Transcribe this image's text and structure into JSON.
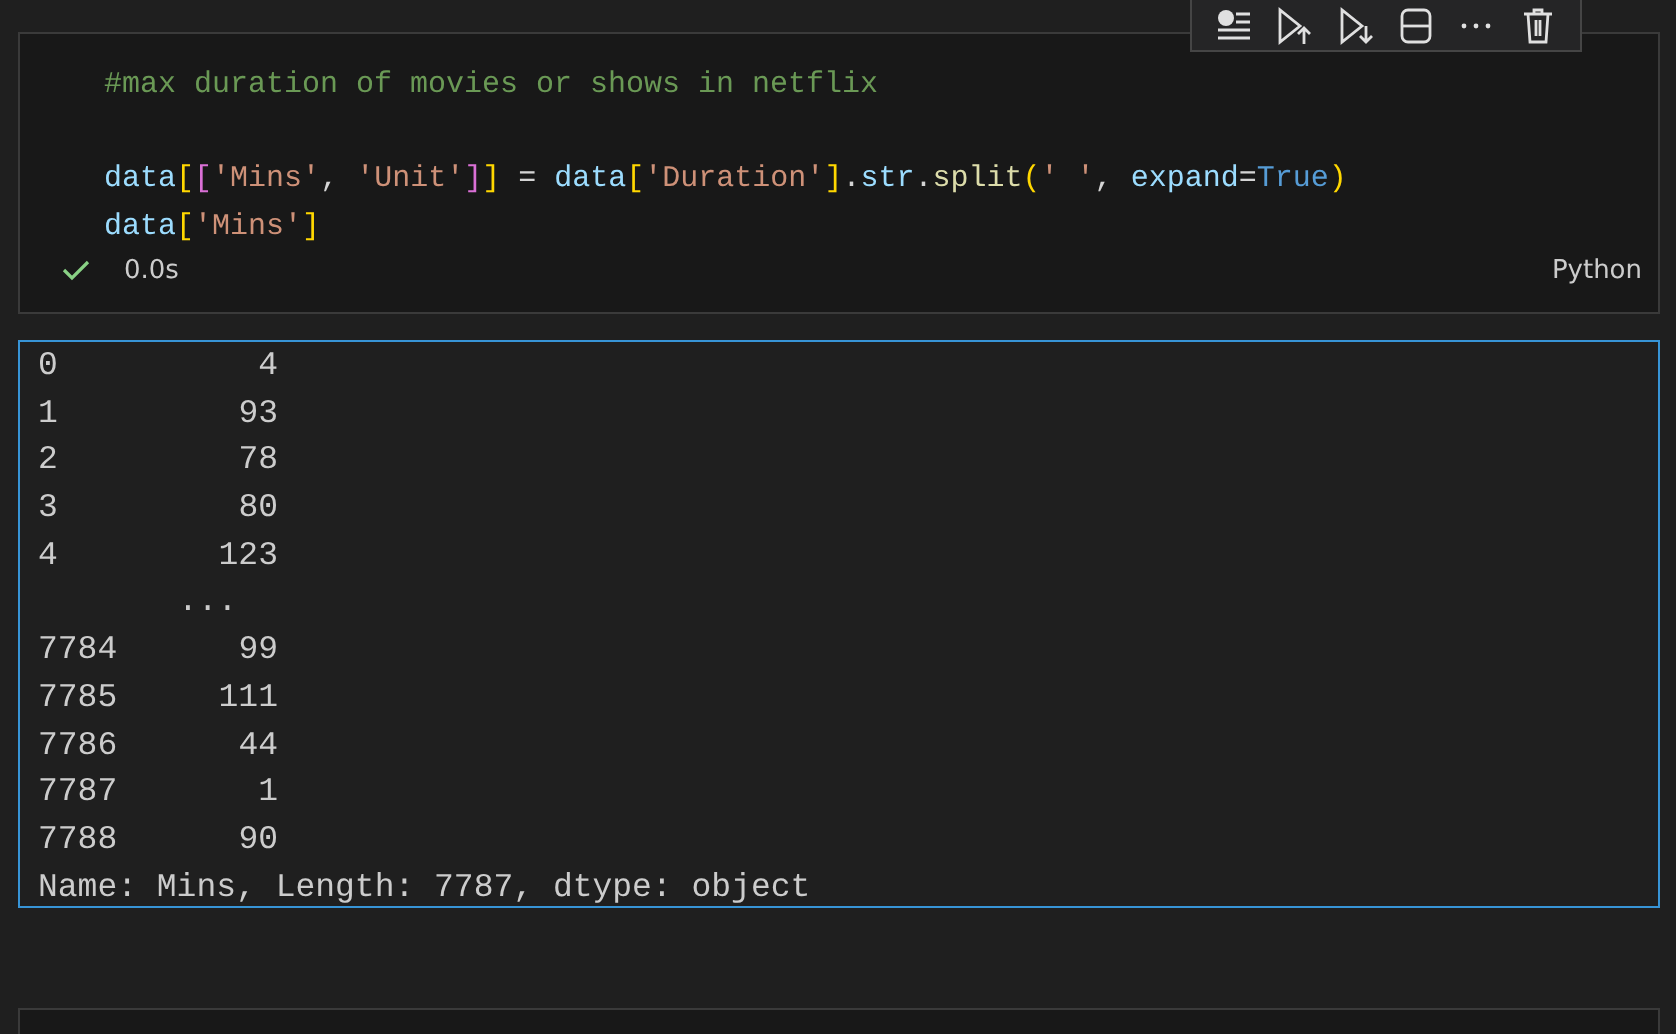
{
  "cell": {
    "code_lines": [
      {
        "kind": "code",
        "tokens": [
          {
            "kind": "comment",
            "text": "#max duration of movies or shows in netflix"
          }
        ]
      },
      {
        "kind": "blank"
      },
      {
        "kind": "code",
        "tokens": [
          {
            "kind": "var",
            "text": "data"
          },
          {
            "kind": "bracket1",
            "text": "["
          },
          {
            "kind": "bracket2",
            "text": "["
          },
          {
            "kind": "string",
            "text": "'Mins'"
          },
          {
            "kind": "plain",
            "text": ", "
          },
          {
            "kind": "string",
            "text": "'Unit'"
          },
          {
            "kind": "bracket2",
            "text": "]"
          },
          {
            "kind": "bracket1",
            "text": "]"
          },
          {
            "kind": "plain",
            "text": " = "
          },
          {
            "kind": "var",
            "text": "data"
          },
          {
            "kind": "bracket1",
            "text": "["
          },
          {
            "kind": "string",
            "text": "'Duration'"
          },
          {
            "kind": "bracket1",
            "text": "]"
          },
          {
            "kind": "plain",
            "text": "."
          },
          {
            "kind": "var",
            "text": "str"
          },
          {
            "kind": "plain",
            "text": "."
          },
          {
            "kind": "func",
            "text": "split"
          },
          {
            "kind": "bracket1",
            "text": "("
          },
          {
            "kind": "string",
            "text": "' '"
          },
          {
            "kind": "plain",
            "text": ", "
          },
          {
            "kind": "var",
            "text": "expand"
          },
          {
            "kind": "plain",
            "text": "="
          },
          {
            "kind": "keyword",
            "text": "True"
          },
          {
            "kind": "bracket1",
            "text": ")"
          }
        ]
      },
      {
        "kind": "code",
        "tokens": [
          {
            "kind": "var",
            "text": "data"
          },
          {
            "kind": "bracket1",
            "text": "["
          },
          {
            "kind": "string",
            "text": "'Mins'"
          },
          {
            "kind": "bracket1",
            "text": "]"
          }
        ]
      }
    ],
    "status": {
      "succeeded": true,
      "duration": "0.0s"
    },
    "language": "Python"
  },
  "output": {
    "rows": [
      {
        "kind": "row",
        "index": "0",
        "value": "4"
      },
      {
        "kind": "row",
        "index": "1",
        "value": "93"
      },
      {
        "kind": "row",
        "index": "2",
        "value": "78"
      },
      {
        "kind": "row",
        "index": "3",
        "value": "80"
      },
      {
        "kind": "row",
        "index": "4",
        "value": "123"
      },
      {
        "kind": "ellipsis",
        "value": "..."
      },
      {
        "kind": "row",
        "index": "7784",
        "value": "99"
      },
      {
        "kind": "row",
        "index": "7785",
        "value": "111"
      },
      {
        "kind": "row",
        "index": "7786",
        "value": "44"
      },
      {
        "kind": "row",
        "index": "7787",
        "value": "1"
      },
      {
        "kind": "row",
        "index": "7788",
        "value": "90"
      }
    ],
    "footer": "Name: Mins, Length: 7787, dtype: object"
  }
}
